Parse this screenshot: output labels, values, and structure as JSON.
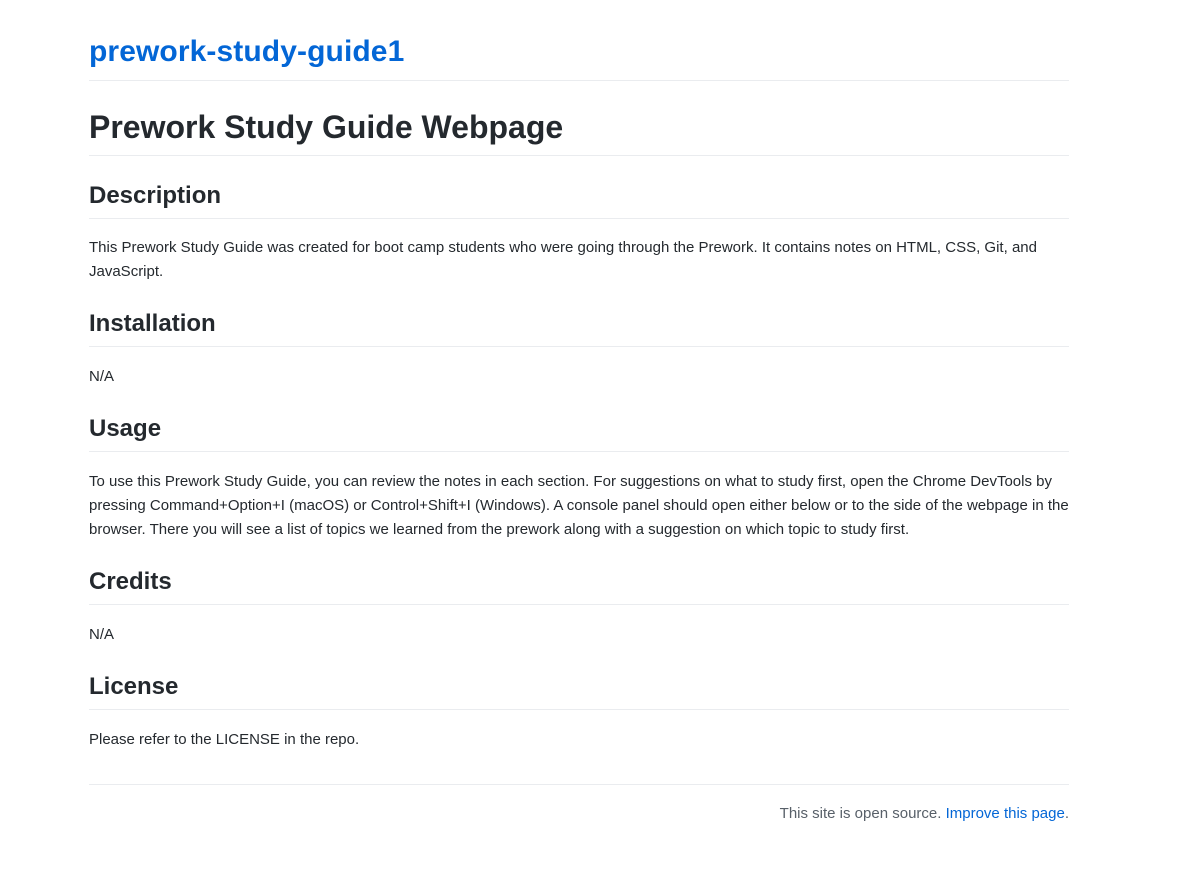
{
  "header": {
    "site_title": "prework-study-guide1"
  },
  "page": {
    "title": "Prework Study Guide Webpage"
  },
  "sections": [
    {
      "heading": "Description",
      "text": "This Prework Study Guide was created for boot camp students who were going through the Prework. It contains notes on HTML, CSS, Git, and JavaScript."
    },
    {
      "heading": "Installation",
      "text": "N/A"
    },
    {
      "heading": "Usage",
      "text": "To use this Prework Study Guide, you can review the notes in each section. For suggestions on what to study first, open the Chrome DevTools by pressing Command+Option+I (macOS) or Control+Shift+I (Windows). A console panel should open either below or to the side of the webpage in the browser. There you will see a list of topics we learned from the prework along with a suggestion on which topic to study first."
    },
    {
      "heading": "Credits",
      "text": "N/A"
    },
    {
      "heading": "License",
      "text": "Please refer to the LICENSE in the repo."
    }
  ],
  "footer": {
    "text": "This site is open source.",
    "link_label": "Improve this page",
    "trailing": "."
  },
  "colors": {
    "link": "#0366d6",
    "text": "#24292e",
    "muted": "#586069",
    "divider": "#eaecef"
  }
}
